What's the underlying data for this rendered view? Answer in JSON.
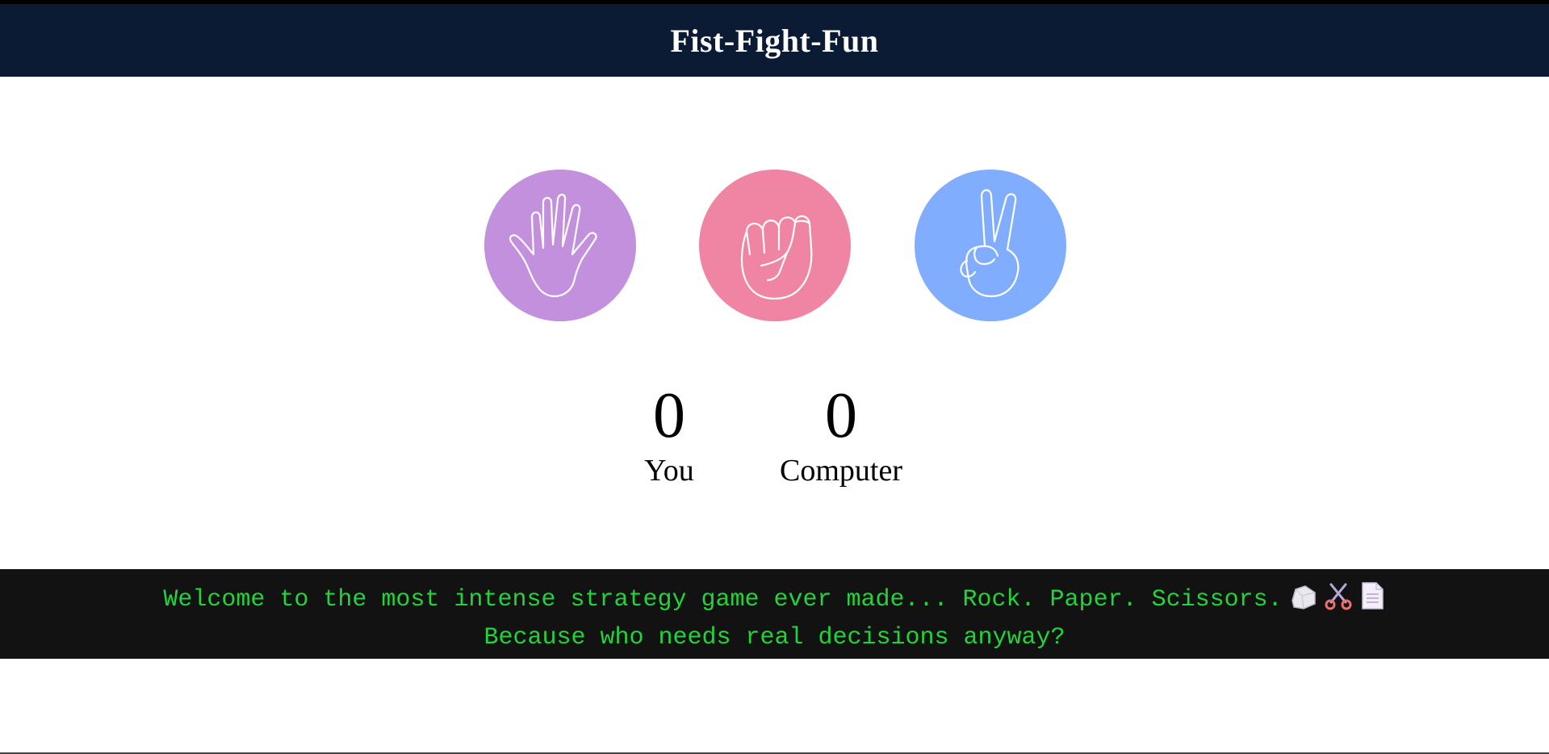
{
  "header": {
    "title": "Fist-Fight-Fun",
    "background": "#0a1b33"
  },
  "choices": [
    {
      "name": "paper",
      "icon": "open-hand-icon",
      "color": "#c390de"
    },
    {
      "name": "rock",
      "icon": "fist-icon",
      "color": "#f085a3"
    },
    {
      "name": "scissors",
      "icon": "peace-hand-icon",
      "color": "#80adfd"
    }
  ],
  "scores": {
    "you": {
      "value": "0",
      "label": "You"
    },
    "computer": {
      "value": "0",
      "label": "Computer"
    }
  },
  "message": {
    "line1": "Welcome to the most intense strategy game ever made... Rock. Paper. Scissors.",
    "line2": "Because who needs real decisions anyway?",
    "icons": [
      "rock-icon",
      "scissors-icon",
      "page-icon"
    ],
    "text_color": "#22d43a",
    "background": "#121212"
  }
}
